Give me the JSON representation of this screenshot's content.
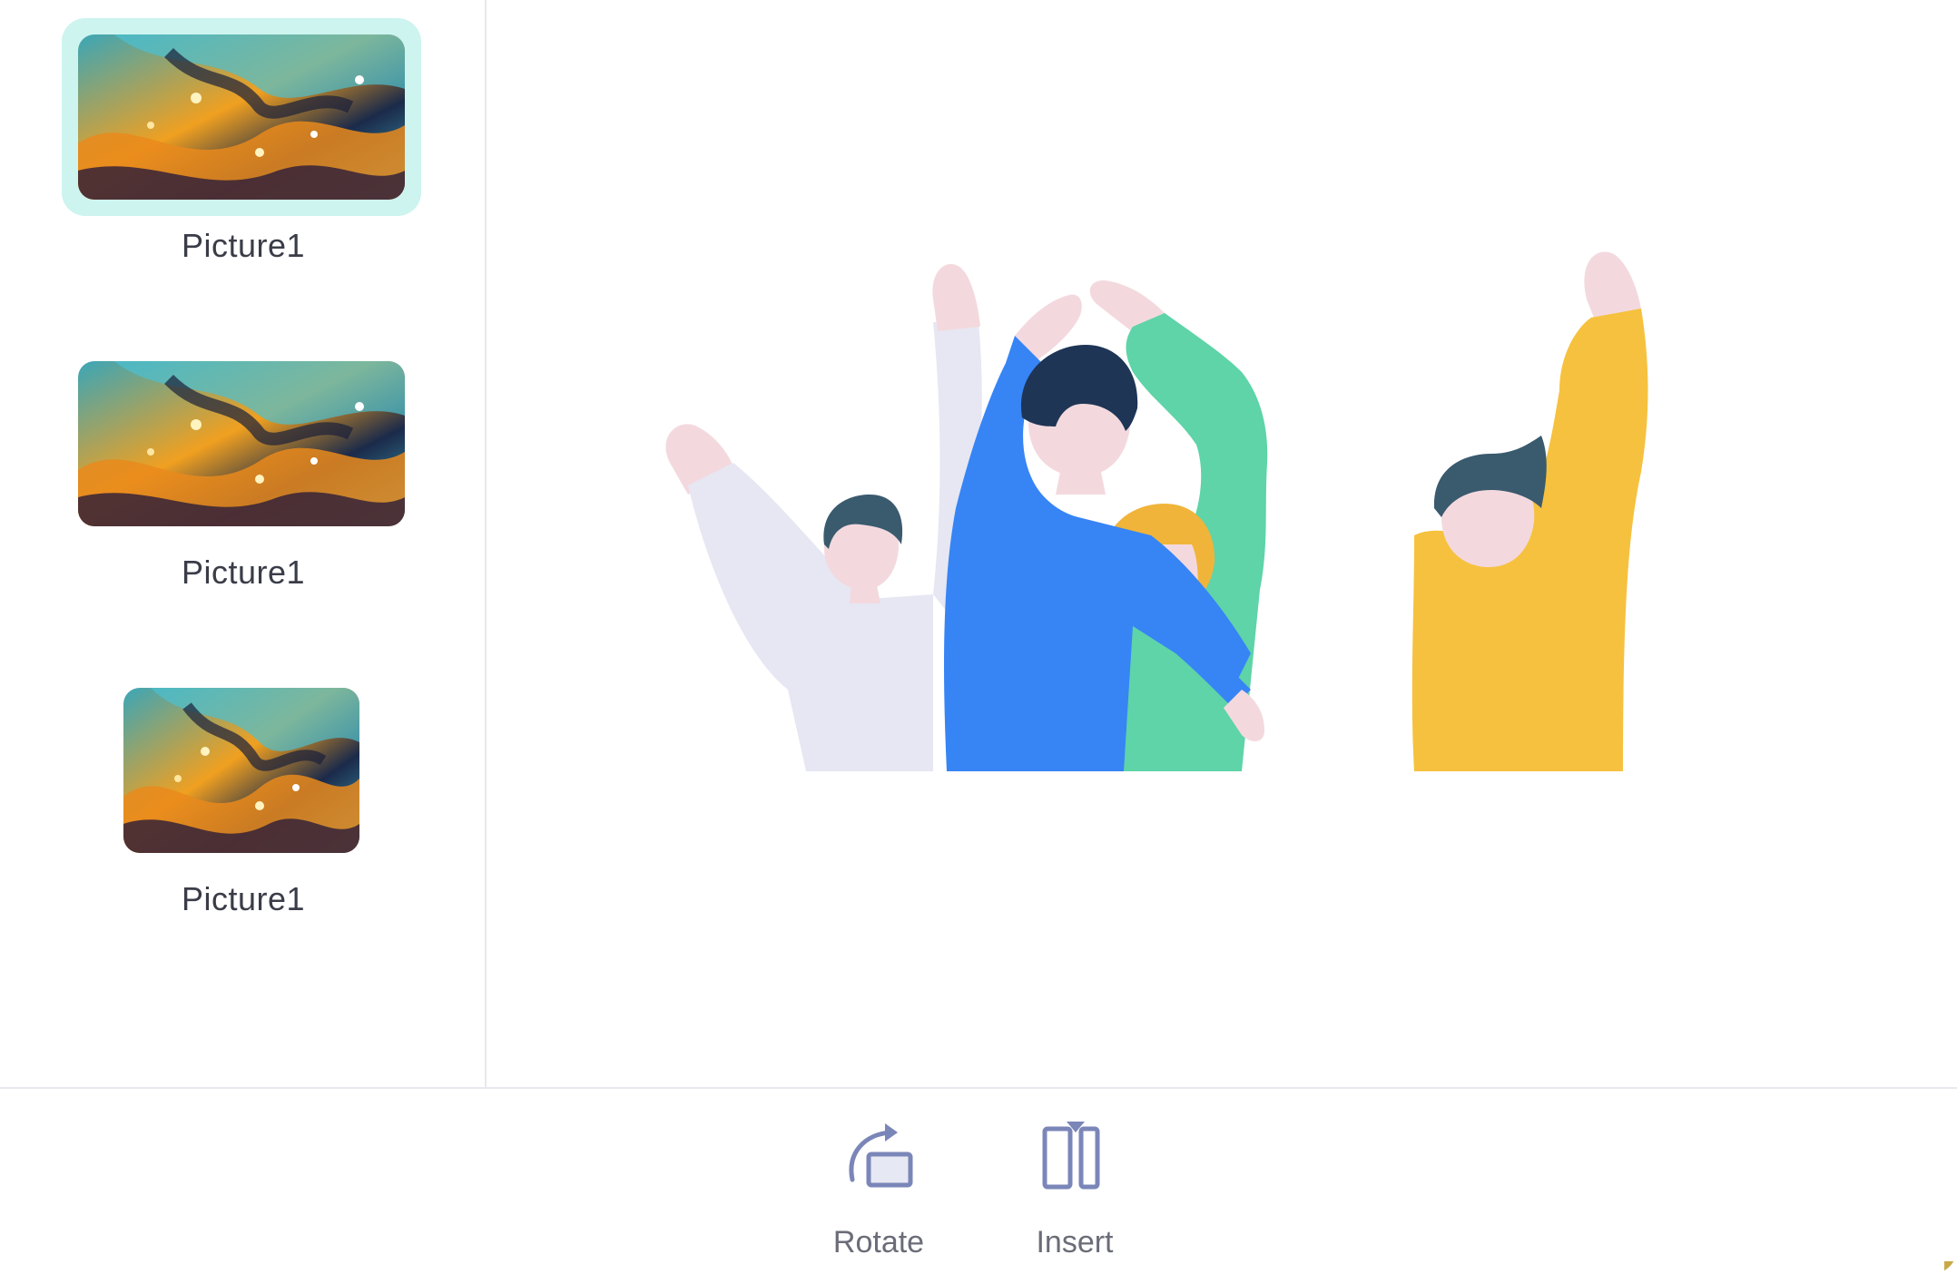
{
  "sidebar": {
    "items": [
      {
        "label": "Picture1",
        "selected": true
      },
      {
        "label": "Picture1",
        "selected": false
      },
      {
        "label": "Picture1",
        "selected": false
      }
    ]
  },
  "toolbar": {
    "rotate_label": "Rotate",
    "insert_label": "Insert"
  },
  "colors": {
    "selected_bg": "#cdf4ef",
    "icon": "#7b86b8",
    "divider": "#e8e9ee"
  }
}
